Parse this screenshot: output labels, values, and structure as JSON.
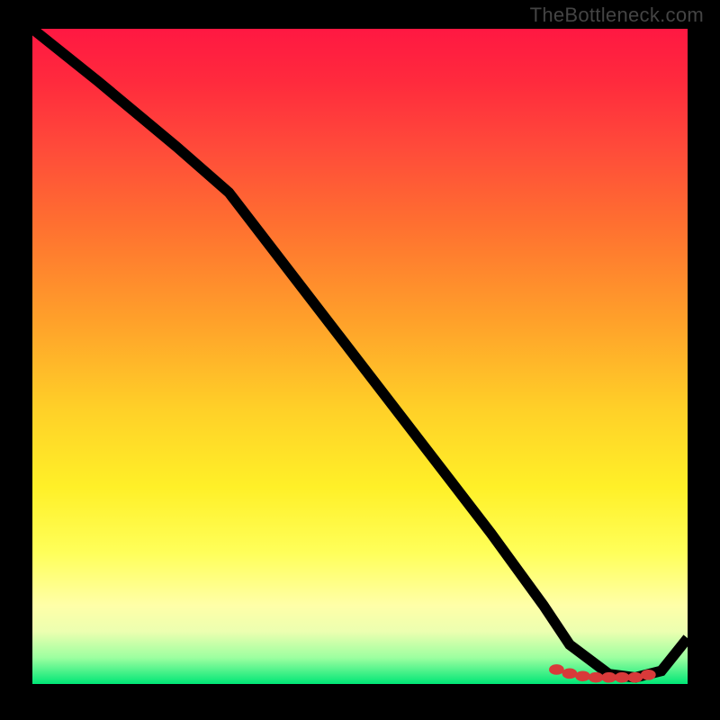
{
  "watermark": "TheBottleneck.com",
  "chart_data": {
    "type": "line",
    "title": "",
    "xlabel": "",
    "ylabel": "",
    "xlim": [
      0,
      100
    ],
    "ylim": [
      0,
      100
    ],
    "grid": false,
    "series": [
      {
        "name": "curve",
        "x": [
          0,
          10,
          22,
          30,
          40,
          50,
          60,
          70,
          78,
          82,
          88,
          92,
          96,
          100
        ],
        "y": [
          100,
          92,
          82,
          75,
          62,
          49,
          36,
          23,
          12,
          6,
          1.5,
          1,
          2,
          7
        ]
      }
    ],
    "markers": {
      "name": "highlight",
      "x": [
        80,
        82,
        84,
        86,
        88,
        90,
        92,
        94
      ],
      "y": [
        2.2,
        1.6,
        1.2,
        1.0,
        1.0,
        1.0,
        1.0,
        1.4
      ]
    },
    "colors": {
      "line": "#000000",
      "marker": "#d83a3a",
      "gradient_top": "#ff1842",
      "gradient_bottom": "#00e676"
    }
  }
}
